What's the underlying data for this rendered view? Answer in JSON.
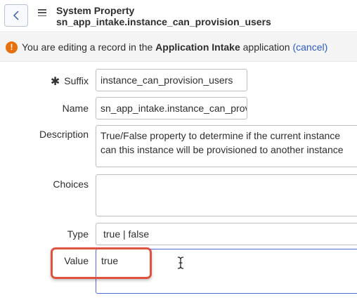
{
  "header": {
    "title": "System Property",
    "subtitle": "sn_app_intake.instance_can_provision_users"
  },
  "banner": {
    "icon": "!",
    "text_prefix": "You are editing a record in the",
    "app_name": "Application Intake",
    "text_suffix": "application",
    "cancel_label": "(cancel)"
  },
  "form": {
    "required_marker": "✱",
    "suffix": {
      "label": "Suffix",
      "value": "instance_can_provision_users"
    },
    "name": {
      "label": "Name",
      "value": "sn_app_intake.instance_can_provi"
    },
    "description": {
      "label": "Description",
      "value": "True/False property to determine if the current instance can this instance will be provisioned to another instance"
    },
    "choices": {
      "label": "Choices",
      "value": ""
    },
    "type": {
      "label": "Type",
      "value": "true | false"
    },
    "value": {
      "label": "Value",
      "value": "true"
    }
  },
  "colors": {
    "warning": "#e8700a",
    "link": "#2b5cc5",
    "highlight": "#e0523f",
    "focus_border": "#4a6fd8"
  }
}
